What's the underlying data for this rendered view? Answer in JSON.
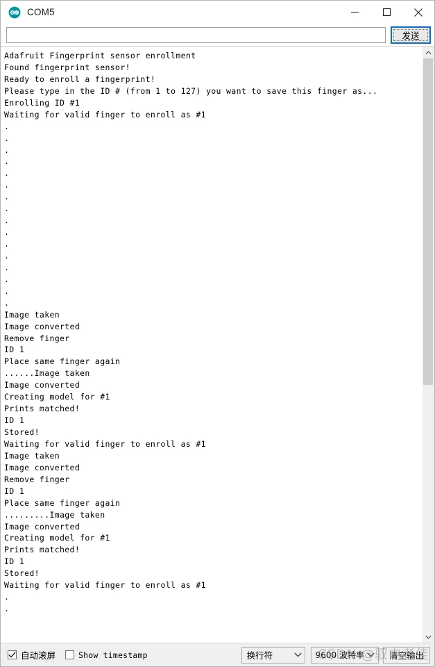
{
  "window": {
    "title": "COM5",
    "app_icon": "arduino-logo-icon",
    "controls": {
      "minimize": "minimize-icon",
      "maximize": "maximize-icon",
      "close": "close-icon"
    }
  },
  "send_bar": {
    "input_value": "",
    "input_placeholder": "",
    "send_label": "发送"
  },
  "console": {
    "lines": [
      "Adafruit Fingerprint sensor enrollment",
      "Found fingerprint sensor!",
      "Ready to enroll a fingerprint!",
      "Please type in the ID # (from 1 to 127) you want to save this finger as...",
      "Enrolling ID #1",
      "Waiting for valid finger to enroll as #1",
      ".",
      ".",
      ".",
      ".",
      ".",
      ".",
      ".",
      ".",
      ".",
      ".",
      ".",
      ".",
      ".",
      ".",
      ".",
      ".",
      "Image taken",
      "Image converted",
      "Remove finger",
      "ID 1",
      "Place same finger again",
      "......Image taken",
      "Image converted",
      "Creating model for #1",
      "Prints matched!",
      "ID 1",
      "Stored!",
      "Waiting for valid finger to enroll as #1",
      "Image taken",
      "Image converted",
      "Remove finger",
      "ID 1",
      "Place same finger again",
      ".........Image taken",
      "Image converted",
      "Creating model for #1",
      "Prints matched!",
      "ID 1",
      "Stored!",
      "Waiting for valid finger to enroll as #1",
      ".",
      "."
    ]
  },
  "scrollbar": {
    "up_arrow": "chevron-up-icon",
    "down_arrow": "chevron-down-icon",
    "thumb_top_percent": 0,
    "thumb_height_percent": 57
  },
  "status_bar": {
    "autoscroll_label": "自动滚屏",
    "autoscroll_checked": true,
    "timestamp_label": "Show timestamp",
    "timestamp_checked": false,
    "line_ending_value": "换行符",
    "baud_value": "9600 波特率",
    "clear_output_label": "清空输出"
  },
  "watermark": {
    "text": "CSDN @驭电者佳"
  },
  "colors": {
    "accent": "#0a6bcb",
    "arduino_teal": "#00979c",
    "chrome_bg": "#f0f0f0",
    "console_bg": "#ffffff",
    "text": "#000000"
  }
}
